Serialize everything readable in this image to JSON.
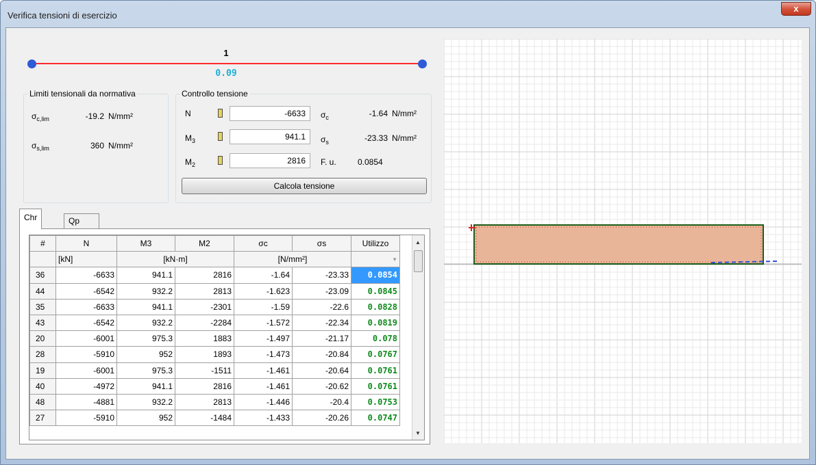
{
  "window": {
    "title": "Verifica tensioni di esercizio",
    "close_glyph": "x"
  },
  "slider": {
    "label": "1",
    "value": "0.09"
  },
  "limits": {
    "title": "Limiti tensionali da normativa",
    "sigma_c": {
      "sym": "σ",
      "sub": "c,lim",
      "value": "-19.2",
      "unit": "N/mm²"
    },
    "sigma_s": {
      "sym": "σ",
      "sub": "s,lim",
      "value": "360",
      "unit": "N/mm²"
    }
  },
  "control": {
    "title": "Controllo tensione",
    "N": {
      "label": "N",
      "value": "-6633"
    },
    "M3": {
      "label": "M",
      "sub": "3",
      "value": "941.1"
    },
    "M2": {
      "label": "M",
      "sub": "2",
      "value": "2816"
    },
    "sigma_c": {
      "sym": "σ",
      "sub": "c",
      "value": "-1.64",
      "unit": "N/mm²"
    },
    "sigma_s": {
      "sym": "σ",
      "sub": "s",
      "value": "-23.33",
      "unit": "N/mm²"
    },
    "fu": {
      "label": "F. u.",
      "value": "0.0854"
    },
    "button": "Calcola tensione"
  },
  "tabs": [
    {
      "label": "Chr"
    },
    {
      "label": "Qp"
    }
  ],
  "table": {
    "headers": [
      "#",
      "N",
      "M3",
      "M2",
      "σc",
      "σs",
      "Utilizzo"
    ],
    "units": {
      "N": "[kN]",
      "M": "[kN·m]",
      "S": "[N/mm²]"
    },
    "rows": [
      [
        "36",
        "-6633",
        "941.1",
        "2816",
        "-1.64",
        "-23.33",
        "0.0854"
      ],
      [
        "44",
        "-6542",
        "932.2",
        "2813",
        "-1.623",
        "-23.09",
        "0.0845"
      ],
      [
        "35",
        "-6633",
        "941.1",
        "-2301",
        "-1.59",
        "-22.6",
        "0.0828"
      ],
      [
        "43",
        "-6542",
        "932.2",
        "-2284",
        "-1.572",
        "-22.34",
        "0.0819"
      ],
      [
        "20",
        "-6001",
        "975.3",
        "1883",
        "-1.497",
        "-21.17",
        "0.078"
      ],
      [
        "28",
        "-5910",
        "952",
        "1893",
        "-1.473",
        "-20.84",
        "0.0767"
      ],
      [
        "19",
        "-6001",
        "975.3",
        "-1511",
        "-1.461",
        "-20.64",
        "0.0761"
      ],
      [
        "40",
        "-4972",
        "941.1",
        "2816",
        "-1.461",
        "-20.62",
        "0.0761"
      ],
      [
        "48",
        "-4881",
        "932.2",
        "2813",
        "-1.446",
        "-20.4",
        "0.0753"
      ],
      [
        "27",
        "-5910",
        "952",
        "-1484",
        "-1.433",
        "-20.26",
        "0.0747"
      ]
    ]
  },
  "colors": {
    "utilizzo": "#0f8a1c",
    "selection": "#3399ff",
    "section_fill": "#e9b598",
    "slider_line": "#ff2a2a",
    "slider_knob": "#2e5bd6"
  },
  "icons": {
    "scroll_up": "▲",
    "scroll_down": "▼",
    "filter": "▼"
  }
}
